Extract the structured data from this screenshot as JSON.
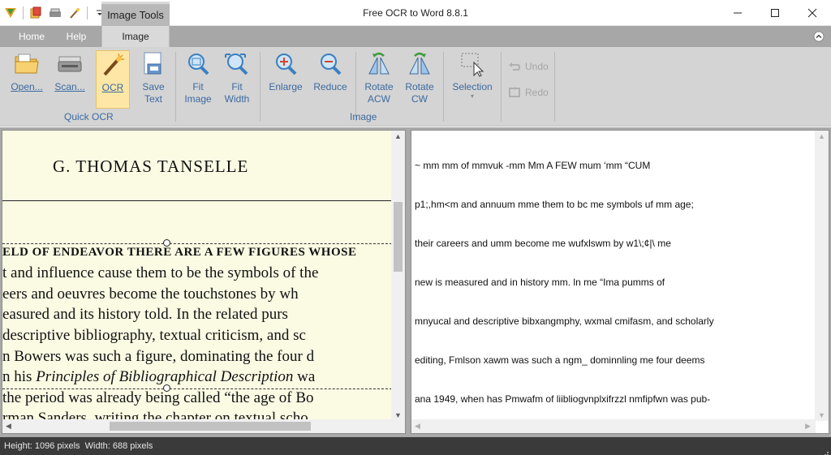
{
  "window": {
    "title": "Free OCR to Word 8.8.1",
    "context_tab": "Image Tools"
  },
  "tabs": {
    "home": "Home",
    "help": "Help",
    "image": "Image"
  },
  "ribbon": {
    "open": "Open...",
    "scan": "Scan...",
    "ocr": "OCR",
    "save_text_1": "Save",
    "save_text_2": "Text",
    "quick_ocr_group": "Quick OCR",
    "fit_image_1": "Fit",
    "fit_image_2": "Image",
    "fit_width_1": "Fit",
    "fit_width_2": "Width",
    "enlarge": "Enlarge",
    "reduce": "Reduce",
    "rotate_acw_1": "Rotate",
    "rotate_acw_2": "ACW",
    "rotate_cw_1": "Rotate",
    "rotate_cw_2": "CW",
    "selection": "Selection",
    "image_group": "Image",
    "undo": "Undo",
    "redo": "Redo"
  },
  "document": {
    "author": "G. THOMAS TANSELLE",
    "lines": [
      "ELD OF ENDEAVOR THERE ARE A FEW FIGURES WHOSE",
      "t and influence cause them to be the symbols of the",
      "eers and oeuvres become the touchstones by wh",
      "easured and its history told. In the related purs",
      "descriptive bibliography, textual criticism, and sc",
      "n Bowers was such a figure, dominating the four d",
      "n his ",
      "Principles of Bibliographical Description",
      " wa",
      "the period was already being called “the age of Bo",
      "rman Sanders, writing the chapter on textual scho"
    ]
  },
  "ocr_output": {
    "lines": [
      "~ mm mm of mmvuk -mm Mm A FEW mum ‘mm “CUM",
      "p1;,hm<m and annuum mme them to bc me symbols uf mm age;",
      "their careers and umm become me wufxlswm by w1\\;¢|\\ me",
      "new is measured and in history mm. ln me “Ima pumms of",
      "mnyucal and descriptive bibxangmphy, wxmal cmifasm, and scholarly",
      "editing, Fmlson xawm was such a ngm_ dominnling me four deems",
      "ana 1949, when has Pmwafm of liibliogvnplxifrzzl nmfipfwn was pub-"
    ]
  },
  "status": {
    "text": "Height: 1096 pixels  Width: 688 pixels"
  },
  "colors": {
    "ribbon": "#d4d4d4",
    "tabbar": "#a7a7a7",
    "ribbon_label": "#3b6aa0",
    "active_button": "#fde6a6",
    "status_bar": "#3a3a3a",
    "page_paper": "#fbfbe4"
  }
}
